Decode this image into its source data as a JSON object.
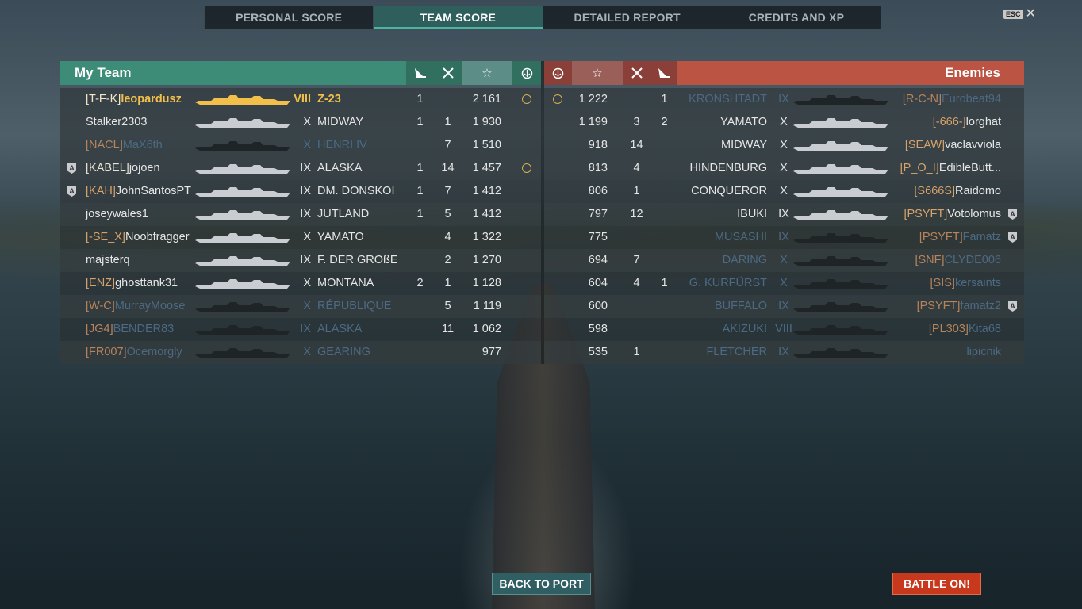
{
  "tabs": [
    {
      "label": "PERSONAL SCORE"
    },
    {
      "label": "TEAM SCORE"
    },
    {
      "label": "DETAILED REPORT"
    },
    {
      "label": "CREDITS AND XP"
    }
  ],
  "esc_label": "ESC",
  "my_team_title": "My Team",
  "enemies_title": "Enemies",
  "buttons": {
    "back_to_port": "BACK TO PORT",
    "battle_on": "BATTLE ON!"
  },
  "colors": {
    "team_header": "#3d8c78",
    "enemy_header": "#bb5443",
    "battle_button": "#c7381d",
    "player_highlight": "#f2c04a"
  },
  "header_icons": [
    "ship-kill-icon",
    "plane-kill-icon",
    "score-star-icon",
    "capture-icon"
  ],
  "my_team": [
    {
      "clan": "[T-F-K]",
      "name": "leopardusz",
      "tier": "VIII",
      "ship": "Z-23",
      "kills": "1",
      "planes": "",
      "score": "2 161",
      "medal": true,
      "me": true
    },
    {
      "clan": "",
      "name": "Stalker2303",
      "tier": "X",
      "ship": "MIDWAY",
      "kills": "1",
      "planes": "1",
      "score": "1 930"
    },
    {
      "clan": "[NACL]",
      "name": "MaX6th",
      "tier": "X",
      "ship": "HENRI IV",
      "kills": "",
      "planes": "7",
      "score": "1 510",
      "dead": true
    },
    {
      "clan": "[KABEL]",
      "name": "jojoen",
      "tier": "IX",
      "ship": "ALASKA",
      "kills": "1",
      "planes": "14",
      "score": "1 457",
      "medal": true,
      "badge": true,
      "clan_hl": true
    },
    {
      "clan": "[KAH]",
      "name": "JohnSantosPT",
      "tier": "IX",
      "ship": "DM. DONSKOI",
      "kills": "1",
      "planes": "7",
      "score": "1 412",
      "badge": true
    },
    {
      "clan": "",
      "name": "joseywales1",
      "tier": "IX",
      "ship": "JUTLAND",
      "kills": "1",
      "planes": "5",
      "score": "1 412"
    },
    {
      "clan": "[-SE_X]",
      "name": "Noobfragger",
      "tier": "X",
      "ship": "YAMATO",
      "kills": "",
      "planes": "4",
      "score": "1 322"
    },
    {
      "clan": "",
      "name": "majsterq",
      "tier": "IX",
      "ship": "F. DER GROßE",
      "kills": "",
      "planes": "2",
      "score": "1 270"
    },
    {
      "clan": "[ENZ]",
      "name": "ghosttank31",
      "tier": "X",
      "ship": "MONTANA",
      "kills": "2",
      "planes": "1",
      "score": "1 128"
    },
    {
      "clan": "[W-C]",
      "name": "MurrayMoose",
      "tier": "X",
      "ship": "RÉPUBLIQUE",
      "kills": "",
      "planes": "5",
      "score": "1 119",
      "dead": true
    },
    {
      "clan": "[JG4]",
      "name": "BENDER83",
      "tier": "IX",
      "ship": "ALASKA",
      "kills": "",
      "planes": "11",
      "score": "1 062",
      "dead": true
    },
    {
      "clan": "[FR007]",
      "name": "Ocemorgly",
      "tier": "X",
      "ship": "GEARING",
      "kills": "",
      "planes": "",
      "score": "977",
      "dead": true
    }
  ],
  "enemies": [
    {
      "clan": "[R-C-N]",
      "name": "Eurobeat94",
      "tier": "IX",
      "ship": "KRONSHTADT",
      "kills": "1",
      "planes": "",
      "score": "1 222",
      "medal": true,
      "dead": true
    },
    {
      "clan": "[-666-]",
      "name": "lorghat",
      "tier": "X",
      "ship": "YAMATO",
      "kills": "2",
      "planes": "3",
      "score": "1 199"
    },
    {
      "clan": "[SEAW]",
      "name": "vaclavviola",
      "tier": "X",
      "ship": "MIDWAY",
      "kills": "",
      "planes": "14",
      "score": "918"
    },
    {
      "clan": "[P_O_I]",
      "name": "EdibleButt...",
      "tier": "X",
      "ship": "HINDENBURG",
      "kills": "",
      "planes": "4",
      "score": "813"
    },
    {
      "clan": "[S666S]",
      "name": "Raidomo",
      "tier": "X",
      "ship": "CONQUEROR",
      "kills": "",
      "planes": "1",
      "score": "806"
    },
    {
      "clan": "[PSYFT]",
      "name": "Votolomus",
      "tier": "IX",
      "ship": "IBUKI",
      "kills": "",
      "planes": "12",
      "score": "797",
      "badge": true
    },
    {
      "clan": "[PSYFT]",
      "name": "Famatz",
      "tier": "IX",
      "ship": "MUSASHI",
      "kills": "",
      "planes": "",
      "score": "775",
      "badge": true,
      "dead": true
    },
    {
      "clan": "[SNF]",
      "name": "CLYDE006",
      "tier": "X",
      "ship": "DARING",
      "kills": "",
      "planes": "7",
      "score": "694",
      "dead": true,
      "clan_hl": true
    },
    {
      "clan": "[SIS]",
      "name": "kersaints",
      "tier": "X",
      "ship": "G. KURFÜRST",
      "kills": "1",
      "planes": "4",
      "score": "604",
      "dead": true
    },
    {
      "clan": "[PSYFT]",
      "name": "famatz2",
      "tier": "IX",
      "ship": "BUFFALO",
      "kills": "",
      "planes": "",
      "score": "600",
      "badge": true,
      "dead": true
    },
    {
      "clan": "[PL303]",
      "name": "Kita68",
      "tier": "VIII",
      "ship": "AKIZUKI",
      "kills": "",
      "planes": "",
      "score": "598",
      "dead": true,
      "clan_hl": true
    },
    {
      "clan": "",
      "name": "lipicnik",
      "tier": "IX",
      "ship": "FLETCHER",
      "kills": "",
      "planes": "1",
      "score": "535",
      "dead": true
    }
  ]
}
